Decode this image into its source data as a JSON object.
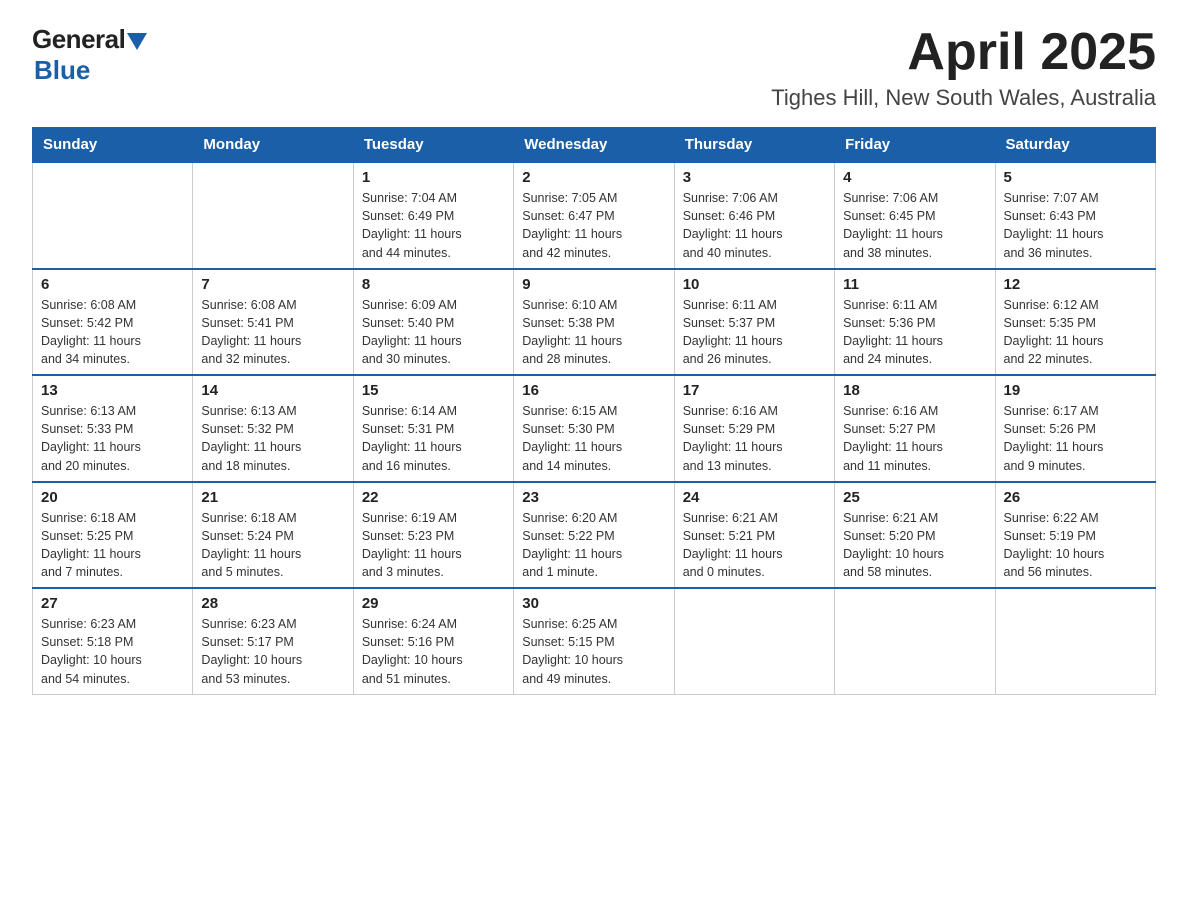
{
  "logo": {
    "general": "General",
    "blue": "Blue"
  },
  "header": {
    "title": "April 2025",
    "subtitle": "Tighes Hill, New South Wales, Australia"
  },
  "days_of_week": [
    "Sunday",
    "Monday",
    "Tuesday",
    "Wednesday",
    "Thursday",
    "Friday",
    "Saturday"
  ],
  "weeks": [
    [
      {
        "day": "",
        "info": ""
      },
      {
        "day": "",
        "info": ""
      },
      {
        "day": "1",
        "info": "Sunrise: 7:04 AM\nSunset: 6:49 PM\nDaylight: 11 hours\nand 44 minutes."
      },
      {
        "day": "2",
        "info": "Sunrise: 7:05 AM\nSunset: 6:47 PM\nDaylight: 11 hours\nand 42 minutes."
      },
      {
        "day": "3",
        "info": "Sunrise: 7:06 AM\nSunset: 6:46 PM\nDaylight: 11 hours\nand 40 minutes."
      },
      {
        "day": "4",
        "info": "Sunrise: 7:06 AM\nSunset: 6:45 PM\nDaylight: 11 hours\nand 38 minutes."
      },
      {
        "day": "5",
        "info": "Sunrise: 7:07 AM\nSunset: 6:43 PM\nDaylight: 11 hours\nand 36 minutes."
      }
    ],
    [
      {
        "day": "6",
        "info": "Sunrise: 6:08 AM\nSunset: 5:42 PM\nDaylight: 11 hours\nand 34 minutes."
      },
      {
        "day": "7",
        "info": "Sunrise: 6:08 AM\nSunset: 5:41 PM\nDaylight: 11 hours\nand 32 minutes."
      },
      {
        "day": "8",
        "info": "Sunrise: 6:09 AM\nSunset: 5:40 PM\nDaylight: 11 hours\nand 30 minutes."
      },
      {
        "day": "9",
        "info": "Sunrise: 6:10 AM\nSunset: 5:38 PM\nDaylight: 11 hours\nand 28 minutes."
      },
      {
        "day": "10",
        "info": "Sunrise: 6:11 AM\nSunset: 5:37 PM\nDaylight: 11 hours\nand 26 minutes."
      },
      {
        "day": "11",
        "info": "Sunrise: 6:11 AM\nSunset: 5:36 PM\nDaylight: 11 hours\nand 24 minutes."
      },
      {
        "day": "12",
        "info": "Sunrise: 6:12 AM\nSunset: 5:35 PM\nDaylight: 11 hours\nand 22 minutes."
      }
    ],
    [
      {
        "day": "13",
        "info": "Sunrise: 6:13 AM\nSunset: 5:33 PM\nDaylight: 11 hours\nand 20 minutes."
      },
      {
        "day": "14",
        "info": "Sunrise: 6:13 AM\nSunset: 5:32 PM\nDaylight: 11 hours\nand 18 minutes."
      },
      {
        "day": "15",
        "info": "Sunrise: 6:14 AM\nSunset: 5:31 PM\nDaylight: 11 hours\nand 16 minutes."
      },
      {
        "day": "16",
        "info": "Sunrise: 6:15 AM\nSunset: 5:30 PM\nDaylight: 11 hours\nand 14 minutes."
      },
      {
        "day": "17",
        "info": "Sunrise: 6:16 AM\nSunset: 5:29 PM\nDaylight: 11 hours\nand 13 minutes."
      },
      {
        "day": "18",
        "info": "Sunrise: 6:16 AM\nSunset: 5:27 PM\nDaylight: 11 hours\nand 11 minutes."
      },
      {
        "day": "19",
        "info": "Sunrise: 6:17 AM\nSunset: 5:26 PM\nDaylight: 11 hours\nand 9 minutes."
      }
    ],
    [
      {
        "day": "20",
        "info": "Sunrise: 6:18 AM\nSunset: 5:25 PM\nDaylight: 11 hours\nand 7 minutes."
      },
      {
        "day": "21",
        "info": "Sunrise: 6:18 AM\nSunset: 5:24 PM\nDaylight: 11 hours\nand 5 minutes."
      },
      {
        "day": "22",
        "info": "Sunrise: 6:19 AM\nSunset: 5:23 PM\nDaylight: 11 hours\nand 3 minutes."
      },
      {
        "day": "23",
        "info": "Sunrise: 6:20 AM\nSunset: 5:22 PM\nDaylight: 11 hours\nand 1 minute."
      },
      {
        "day": "24",
        "info": "Sunrise: 6:21 AM\nSunset: 5:21 PM\nDaylight: 11 hours\nand 0 minutes."
      },
      {
        "day": "25",
        "info": "Sunrise: 6:21 AM\nSunset: 5:20 PM\nDaylight: 10 hours\nand 58 minutes."
      },
      {
        "day": "26",
        "info": "Sunrise: 6:22 AM\nSunset: 5:19 PM\nDaylight: 10 hours\nand 56 minutes."
      }
    ],
    [
      {
        "day": "27",
        "info": "Sunrise: 6:23 AM\nSunset: 5:18 PM\nDaylight: 10 hours\nand 54 minutes."
      },
      {
        "day": "28",
        "info": "Sunrise: 6:23 AM\nSunset: 5:17 PM\nDaylight: 10 hours\nand 53 minutes."
      },
      {
        "day": "29",
        "info": "Sunrise: 6:24 AM\nSunset: 5:16 PM\nDaylight: 10 hours\nand 51 minutes."
      },
      {
        "day": "30",
        "info": "Sunrise: 6:25 AM\nSunset: 5:15 PM\nDaylight: 10 hours\nand 49 minutes."
      },
      {
        "day": "",
        "info": ""
      },
      {
        "day": "",
        "info": ""
      },
      {
        "day": "",
        "info": ""
      }
    ]
  ]
}
